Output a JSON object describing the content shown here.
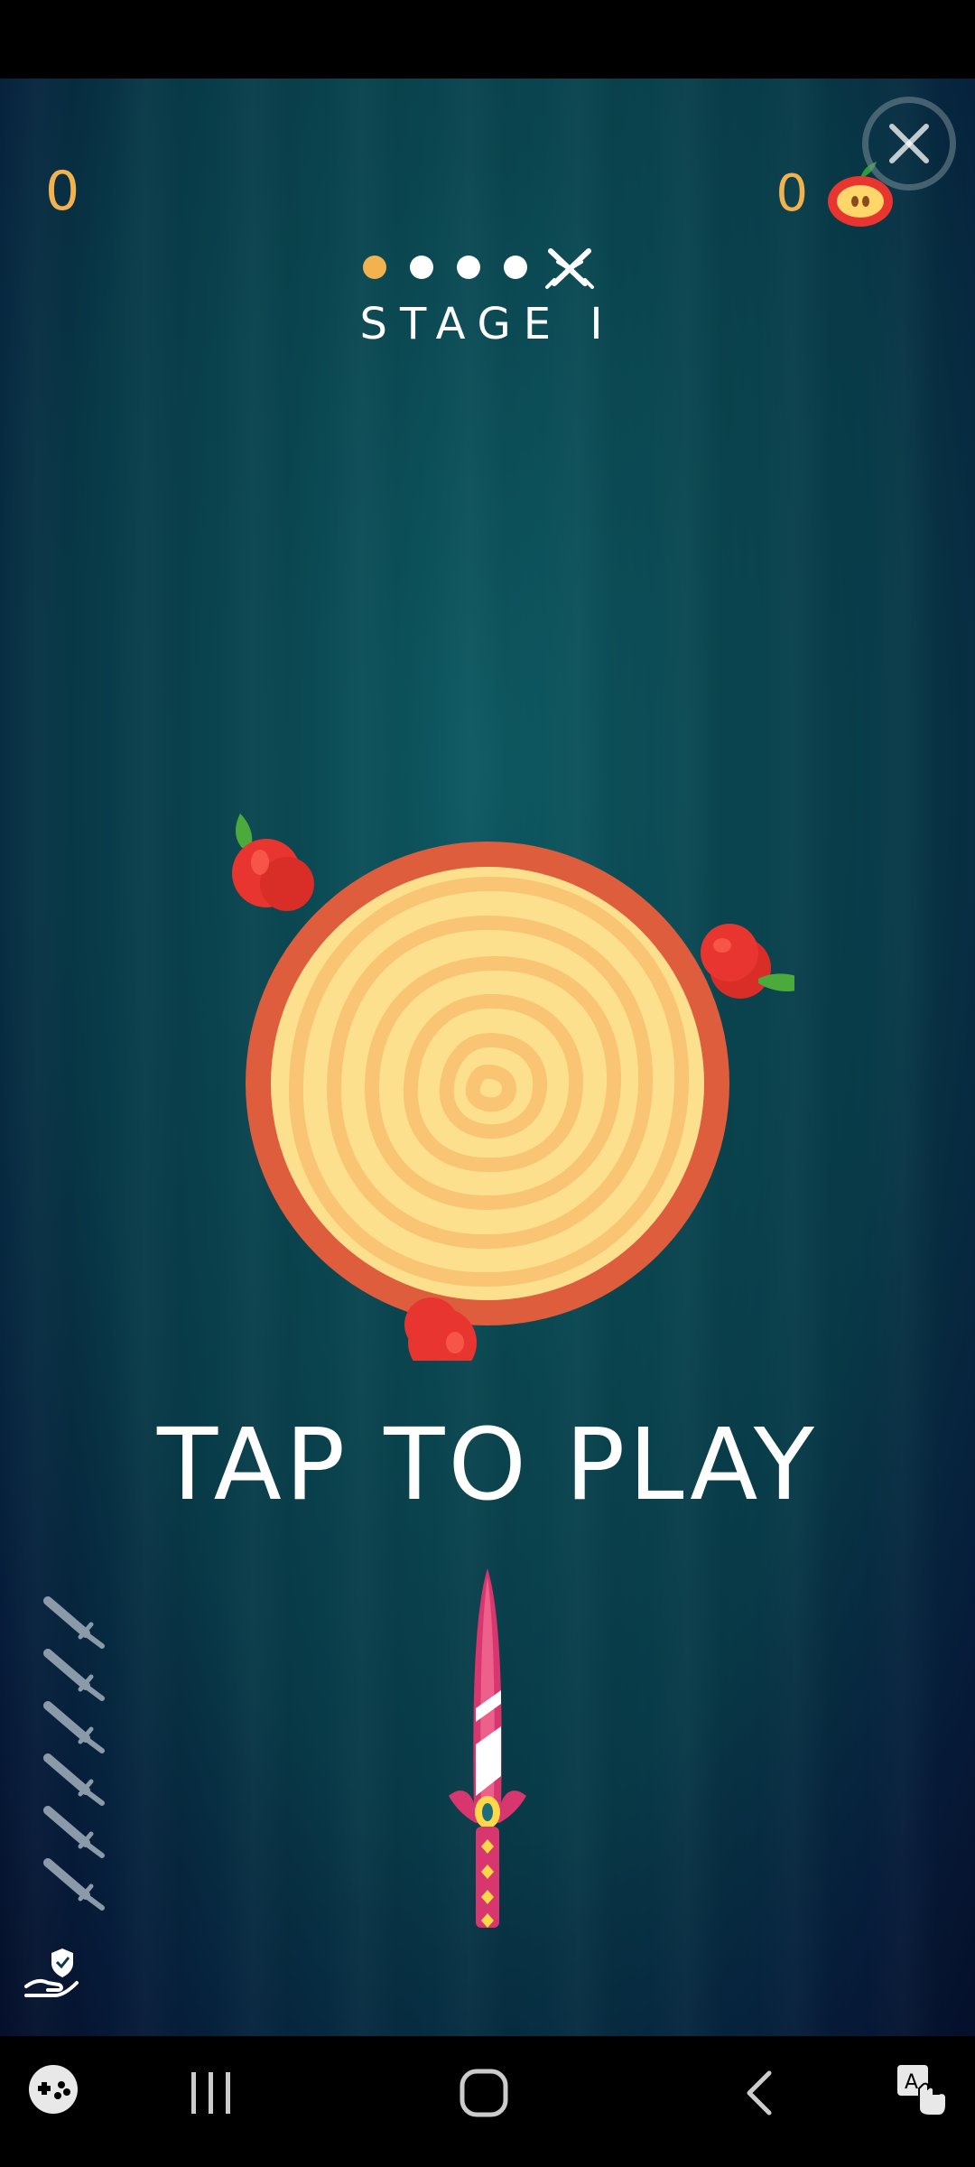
{
  "hud": {
    "score": "0",
    "apples": "0",
    "stage_label": "STAGE I",
    "stage_progress": {
      "total": 5,
      "current": 1,
      "boss_icon": "crossed-swords-icon"
    },
    "close_icon": "close-icon"
  },
  "main": {
    "prompt": "TAP TO PLAY"
  },
  "knives_remaining": 6,
  "colors": {
    "accent": "#f2b34f",
    "target_rim": "#de5d3c",
    "target_face": "#fde08d",
    "apple": "#e8352f",
    "knife": "#d8366e"
  },
  "navigation": {
    "left_icon": "game-launcher-icon",
    "recents_icon": "recents-icon",
    "home_icon": "home-icon",
    "back_icon": "back-icon",
    "right_icon": "accessibility-touch-icon"
  }
}
